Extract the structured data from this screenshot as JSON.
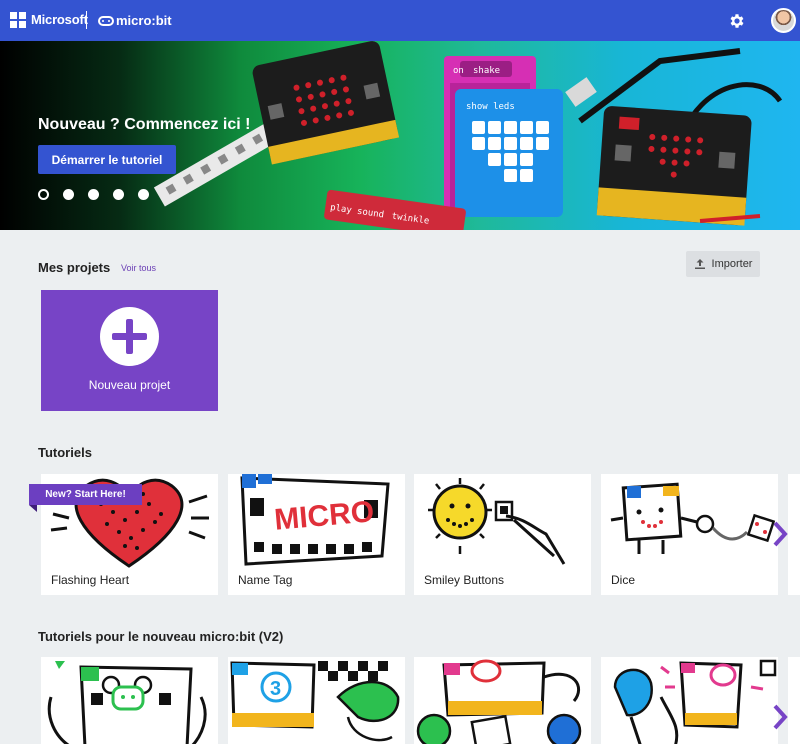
{
  "header": {
    "brand_microsoft": "Microsoft",
    "brand_microbit": "micro:bit",
    "settings_icon": "gear-icon",
    "avatar_icon": "user-avatar"
  },
  "hero": {
    "title": "Nouveau ? Commencez ici !",
    "cta": "Démarrer le tutoriel",
    "slide_count": 5,
    "active_slide": 1,
    "art_labels": {
      "on": "on",
      "shake": "shake",
      "show_leds": "show leds",
      "play_sound": "play sound",
      "twinkle": "twinkle"
    }
  },
  "projects": {
    "title": "Mes projets",
    "see_all": "Voir tous",
    "import_label": "Importer",
    "new_project_label": "Nouveau projet"
  },
  "tutorials": {
    "title": "Tutoriels",
    "badge": "New? Start Here!",
    "items": [
      {
        "label": "Flashing Heart"
      },
      {
        "label": "Name Tag"
      },
      {
        "label": "Smiley Buttons"
      },
      {
        "label": "Dice"
      }
    ],
    "name_tag_art": "MICRO"
  },
  "v2": {
    "title": "Tutoriels pour le nouveau micro:bit (V2)"
  },
  "colors": {
    "header": "#3454d1",
    "accent_purple": "#7744c6",
    "page_bg": "#eceff1"
  }
}
